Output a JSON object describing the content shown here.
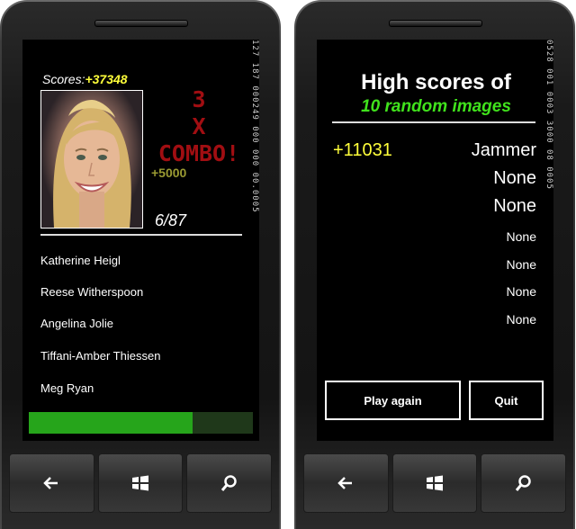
{
  "quiz": {
    "system_tray": "127 187 000249 000 000 00.0005",
    "scores_label": "Scores:",
    "scores_value": "+37348",
    "combo_lines": [
      "3",
      "X",
      "COMBO!"
    ],
    "combo_bonus": "+5000",
    "progress_text": "6/87",
    "answers": [
      "Katherine Heigl",
      "Reese Witherspoon",
      "Angelina Jolie",
      "Tiffani-Amber Thiessen",
      "Meg Ryan"
    ],
    "timer_remaining_fraction": 0.73,
    "colors": {
      "score_yellow": "#ffff3a",
      "combo_red": "#a10e12",
      "timer_green": "#26a51b"
    }
  },
  "highscores": {
    "system_tray": "0528 001 0003 3000 08 0005",
    "title": "High scores of",
    "subtitle": "10 random images",
    "entries": [
      {
        "points": "+11031",
        "name": "Jammer"
      },
      {
        "points": "",
        "name": "None"
      },
      {
        "points": "",
        "name": "None"
      },
      {
        "points": "",
        "name": "None"
      },
      {
        "points": "",
        "name": "None"
      },
      {
        "points": "",
        "name": "None"
      },
      {
        "points": "",
        "name": "None"
      }
    ],
    "play_again_label": "Play again",
    "quit_label": "Quit",
    "colors": {
      "subtitle_green": "#40e21c"
    }
  },
  "hardware_buttons": [
    "back-arrow-icon",
    "windows-logo-icon",
    "search-icon"
  ]
}
